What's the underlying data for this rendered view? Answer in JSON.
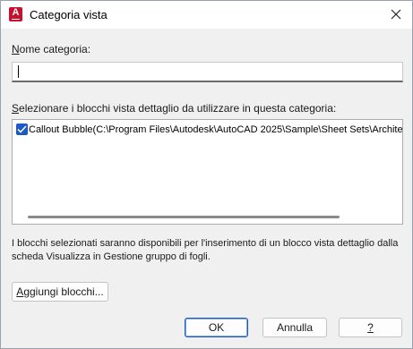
{
  "window": {
    "title": "Categoria vista",
    "app_icon_letter": "A"
  },
  "name_field": {
    "label_accel": "N",
    "label_rest": "ome categoria:",
    "value": ""
  },
  "list": {
    "label_accel": "S",
    "label_rest": "elezionare i blocchi vista dettaglio da utilizzare in questa categoria:",
    "items": [
      {
        "checked": true,
        "text": "Callout Bubble(C:\\Program Files\\Autodesk\\AutoCAD 2025\\Sample\\Sheet Sets\\Architectu"
      }
    ]
  },
  "info_text": "I blocchi selezionati saranno disponibili per l'inserimento di un blocco vista dettaglio dalla scheda Visualizza in Gestione gruppo di fogli.",
  "buttons": {
    "add_accel": "A",
    "add_rest": "ggiungi blocchi...",
    "ok": "OK",
    "cancel": "Annulla",
    "help": "?"
  },
  "colors": {
    "accent": "#1d5bc4",
    "app_icon": "#c8102e"
  }
}
